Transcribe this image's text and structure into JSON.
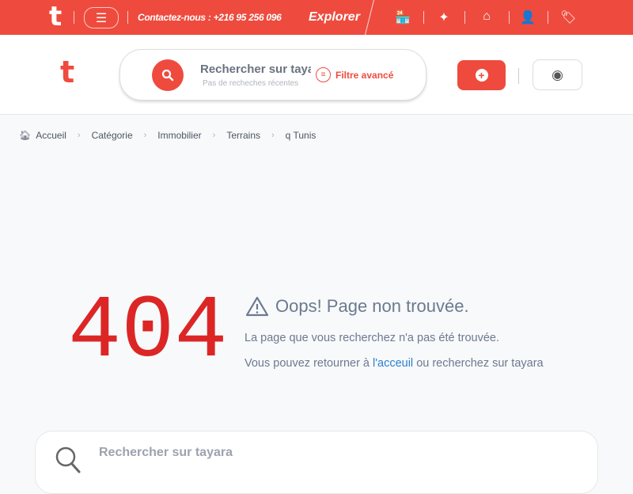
{
  "topbar": {
    "logo": "t",
    "menu_icon": "☰",
    "contact": "Contactez-nous : +216 95 256 096",
    "explorer": "Explorer",
    "icons": [
      "shop-icon",
      "sparkle-icon",
      "home-icon",
      "user-tie-icon",
      "tag-icon"
    ]
  },
  "header": {
    "logo": "t",
    "search_placeholder": "Rechercher sur tayara",
    "recent": "Pas de recheches récentes",
    "filter": "Filtre avancé"
  },
  "breadcrumb": [
    "Accueil",
    "Catégorie",
    "Immobilier",
    "Terrains",
    "q Tunis"
  ],
  "error": {
    "code": "404",
    "title": "Oops! Page non trouvée.",
    "message": "La page que vous recherchez n'a pas été trouvée.",
    "return_prefix": "Vous pouvez retourner à ",
    "return_link": "l'acceuil",
    "return_suffix": " ou recherchez sur tayara"
  },
  "bottom_search": {
    "placeholder": "Rechercher sur tayara"
  },
  "colors": {
    "brand": "#ee4b3e",
    "error": "#dc2626",
    "link": "#2a7fd4"
  }
}
